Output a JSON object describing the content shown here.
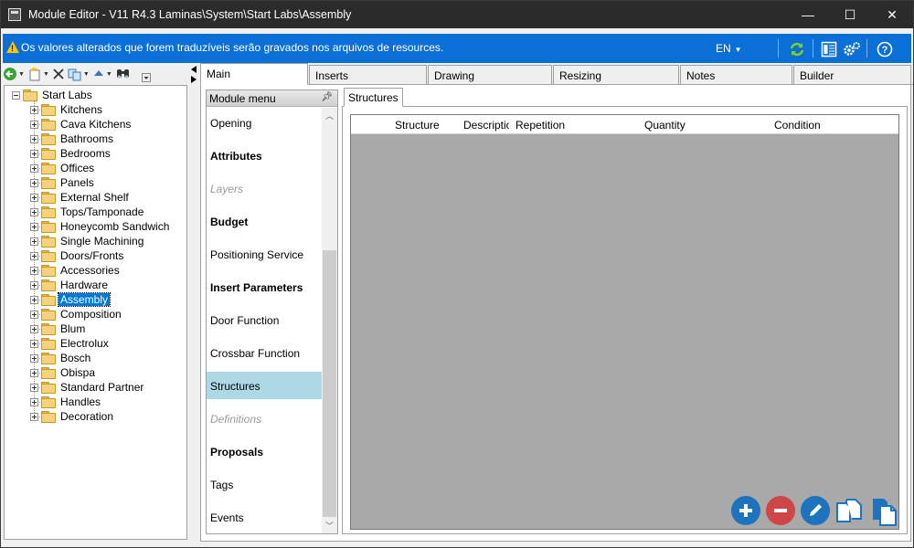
{
  "window": {
    "title": "Module Editor - V11 R4.3 Laminas\\System\\Start Labs\\Assembly",
    "controls": {
      "minimize": "—",
      "maximize": "☐",
      "close": "✕"
    }
  },
  "infobar": {
    "message": "Os valores alterados que forem traduzíveis serão gravados nos arquivos de resources.",
    "language": "EN",
    "accent_color": "#0a6fd6"
  },
  "tree": {
    "root": "Start Labs",
    "items": [
      "Kitchens",
      "Cava Kitchens",
      "Bathrooms",
      "Bedrooms",
      "Offices",
      "Panels",
      "External Shelf",
      "Tops/Tamponade",
      "Honeycomb Sandwich",
      "Single Machining",
      "Doors/Fronts",
      "Accessories",
      "Hardware",
      "Assembly",
      "Composition",
      "Blum",
      "Electrolux",
      "Bosch",
      "Obispa",
      "Standard Partner",
      "Handles",
      "Decoration"
    ],
    "selected": "Assembly"
  },
  "tabs": [
    "Main",
    "Inserts",
    "Drawing",
    "Resizing",
    "Notes",
    "Builder"
  ],
  "active_tab": "Main",
  "module_menu": {
    "header": "Module menu",
    "items": [
      {
        "label": "Opening",
        "style": "normal"
      },
      {
        "label": "Attributes",
        "style": "bold"
      },
      {
        "label": "Layers",
        "style": "disabled"
      },
      {
        "label": "Budget",
        "style": "bold"
      },
      {
        "label": "Positioning Service",
        "style": "normal"
      },
      {
        "label": "Insert Parameters",
        "style": "bold"
      },
      {
        "label": "Door Function",
        "style": "normal"
      },
      {
        "label": "Crossbar Function",
        "style": "normal"
      },
      {
        "label": "Structures",
        "style": "selected"
      },
      {
        "label": "Definitions",
        "style": "disabled"
      },
      {
        "label": "Proposals",
        "style": "bold"
      },
      {
        "label": "Tags",
        "style": "normal"
      },
      {
        "label": "Events",
        "style": "normal"
      }
    ]
  },
  "structures": {
    "tab_label": "Structures",
    "columns": [
      "Structure",
      "Description",
      "Repetition",
      "Quantity",
      "Condition"
    ]
  },
  "actions": {
    "add_color": "#1e73be",
    "remove_color": "#d04545",
    "edit_color": "#1e73be"
  }
}
